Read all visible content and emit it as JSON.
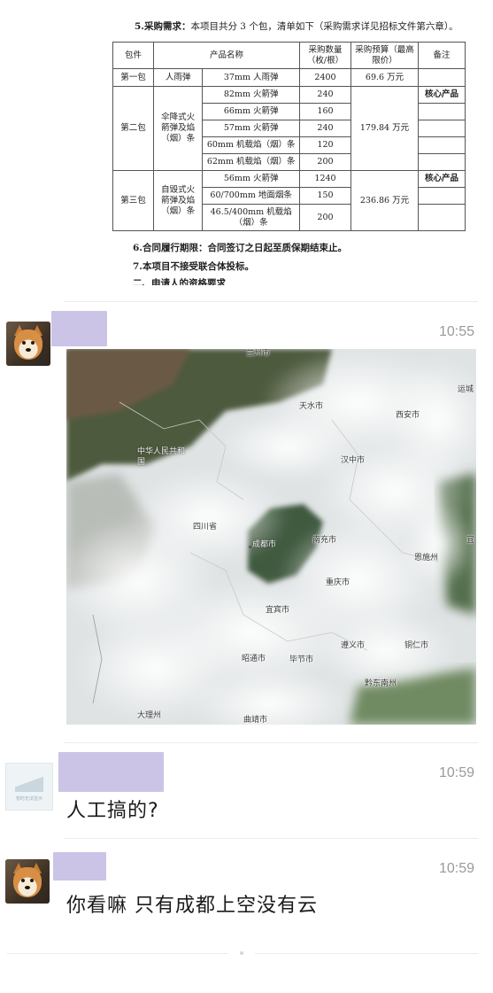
{
  "document": {
    "heading_bold": "5.采购需求：",
    "heading_rest": "本项目共分 3 个包，清单如下（采购需求详见招标文件第六章）。",
    "table": {
      "headers": [
        "包件",
        "产品名称",
        "采购数量（枚/根）",
        "采购预算（最高限价）",
        "备注"
      ],
      "rows": [
        {
          "package": "第一包",
          "category": "人雨弹",
          "product": "37mm 人雨弹",
          "qty": "2400",
          "budget": "69.6 万元",
          "note": ""
        },
        {
          "package": "第二包",
          "category": "伞降式火箭弹及焰（烟）条",
          "product": "82mm 火箭弹",
          "qty": "240",
          "budget": "179.84 万元",
          "note": "核心产品"
        },
        {
          "product": "66mm 火箭弹",
          "qty": "160",
          "note": ""
        },
        {
          "product": "57mm 火箭弹",
          "qty": "240",
          "note": ""
        },
        {
          "product": "60mm 机载焰（烟）条",
          "qty": "120",
          "note": ""
        },
        {
          "product": "62mm 机载焰（烟）条",
          "qty": "200",
          "note": ""
        },
        {
          "package": "第三包",
          "category": "自毁式火箭弹及焰（烟）条",
          "product": "56mm 火箭弹",
          "qty": "1240",
          "budget": "236.86 万元",
          "note": "核心产品"
        },
        {
          "product": "60/700mm 地面烟条",
          "qty": "150",
          "note": ""
        },
        {
          "product": "46.5/400mm 机载焰（烟）条",
          "qty": "200",
          "note": ""
        }
      ]
    },
    "note6": "6.合同履行期限：合同签订之日起至质保期结束止。",
    "note7": "7.本项目不接受联合体投标。",
    "note8_partial": "二、申请人的资格要求"
  },
  "messages": [
    {
      "time": "10:55",
      "type": "image",
      "avatar": "shiba-dog-avatar"
    },
    {
      "time": "10:59",
      "type": "text",
      "text": "人工搞的?",
      "avatar": "placeholder-avatar",
      "avatar_caption": "暂时无法显示"
    },
    {
      "time": "10:59",
      "type": "text",
      "text": "你看嘛  只有成都上空没有云",
      "avatar": "shiba-dog-avatar"
    }
  ],
  "satellite": {
    "labels": [
      "兰州市",
      "天水市",
      "西安市",
      "运城",
      "中华人民共和国",
      "汉中市",
      "四川省",
      "成都市",
      "南充市",
      "重庆市",
      "恩施州",
      "宜",
      "宜宾市",
      "昭通市",
      "毕节市",
      "遵义市",
      "铜仁市",
      "黔东南州",
      "大理州",
      "曲靖市"
    ]
  },
  "colors": {
    "namebar": "#cbc4e6",
    "time": "#9a9a9a",
    "divider": "#ececec"
  }
}
